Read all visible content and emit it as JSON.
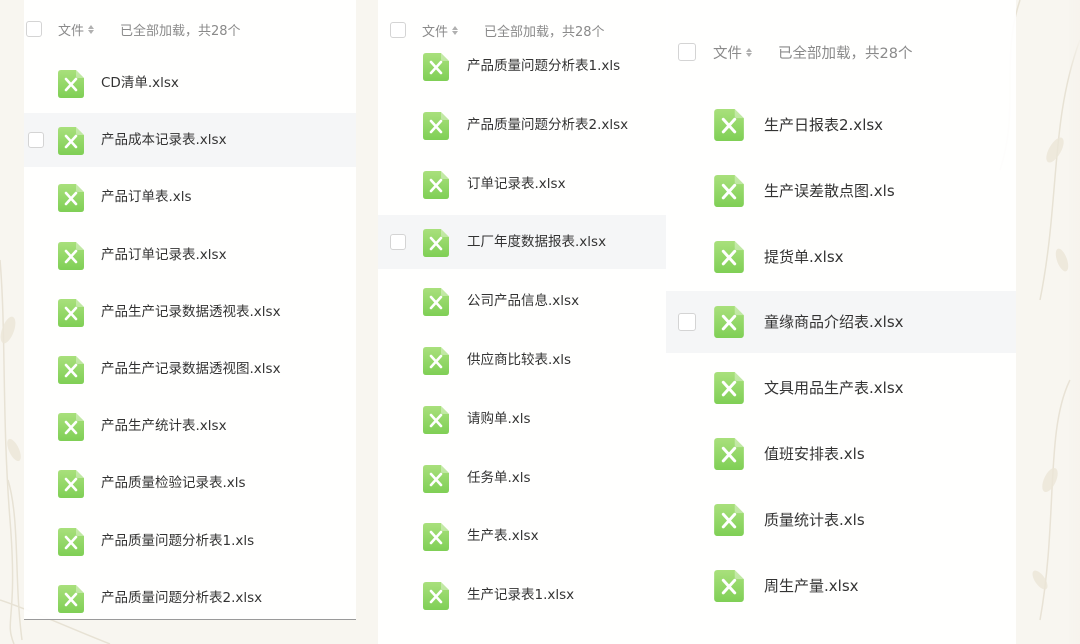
{
  "colors": {
    "excel_green_top": "#a9e07c",
    "excel_green_bottom": "#7fcf55",
    "row_hover": "#f5f6f7",
    "header_text": "#8a8a8a"
  },
  "icons": {
    "file": "excel-file-icon",
    "sort": "sort-icon",
    "checkbox": "checkbox"
  },
  "panels": [
    {
      "header": {
        "file_col": "文件",
        "summary": "已全部加载，共28个"
      },
      "files": [
        "CD清单.xlsx",
        "产品成本记录表.xlsx",
        "产品订单表.xls",
        "产品订单记录表.xlsx",
        "产品生产记录数据透视表.xlsx",
        "产品生产记录数据透视图.xlsx",
        "产品生产统计表.xlsx",
        "产品质量检验记录表.xls",
        "产品质量问题分析表1.xls",
        "产品质量问题分析表2.xlsx"
      ],
      "hover_index": 1
    },
    {
      "header": {
        "file_col": "文件",
        "summary": "已全部加载，共28个"
      },
      "files": [
        "产品质量问题分析表1.xls",
        "产品质量问题分析表2.xlsx",
        "订单记录表.xlsx",
        "工厂年度数据报表.xlsx",
        "公司产品信息.xlsx",
        "供应商比较表.xls",
        "请购单.xls",
        "任务单.xls",
        "生产表.xlsx",
        "生产记录表1.xlsx"
      ],
      "hover_index": 3
    },
    {
      "header": {
        "file_col": "文件",
        "summary": "已全部加载，共28个"
      },
      "files": [
        "生产日报表2.xlsx",
        "生产误差散点图.xls",
        "提货单.xlsx",
        "童缘商品介绍表.xlsx",
        "文具用品生产表.xlsx",
        "值班安排表.xls",
        "质量统计表.xls",
        "周生产量.xlsx"
      ],
      "hover_index": 3
    }
  ]
}
